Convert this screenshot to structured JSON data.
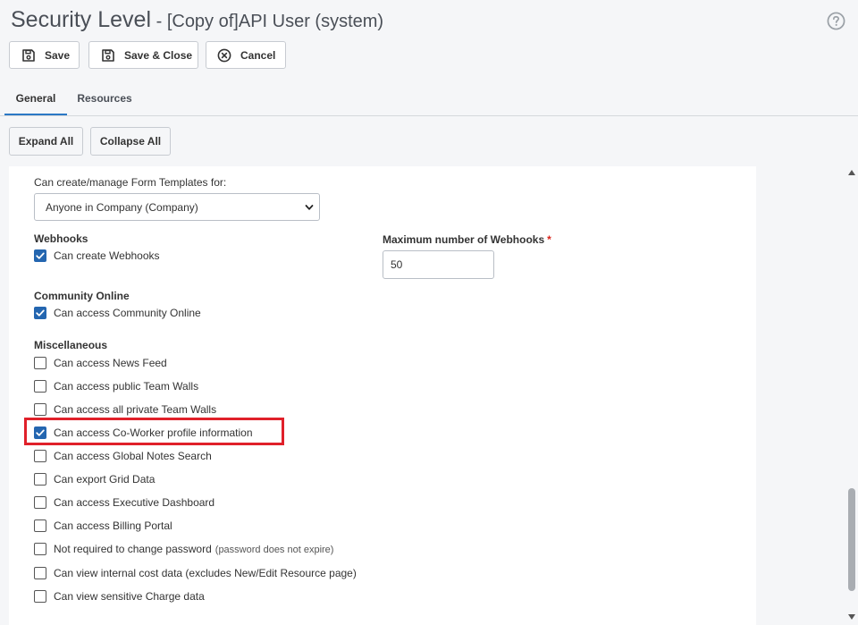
{
  "header": {
    "title": "Security Level",
    "separator": " - ",
    "subtitle": "[Copy of]API User (system)"
  },
  "toolbar": {
    "save_label": "Save",
    "save_close_label": "Save & Close",
    "cancel_label": "Cancel"
  },
  "tabs": [
    {
      "label": "General",
      "active": true
    },
    {
      "label": "Resources",
      "active": false
    }
  ],
  "actions": {
    "expand_label": "Expand All",
    "collapse_label": "Collapse All"
  },
  "form_templates": {
    "label": "Can create/manage Form Templates for:",
    "selected": "Anyone in Company (Company)"
  },
  "webhooks": {
    "heading": "Webhooks",
    "checkbox_label": "Can create Webhooks",
    "checked": true,
    "max_label": "Maximum number of Webhooks",
    "required_mark": "*",
    "max_value": "50"
  },
  "community": {
    "heading": "Community Online",
    "checkbox_label": "Can access Community Online",
    "checked": true
  },
  "misc": {
    "heading": "Miscellaneous",
    "items": [
      {
        "label": "Can access News Feed",
        "note": "",
        "checked": false
      },
      {
        "label": "Can access public Team Walls",
        "note": "",
        "checked": false
      },
      {
        "label": "Can access all private Team Walls",
        "note": "",
        "checked": false
      },
      {
        "label": "Can access Co-Worker profile information",
        "note": "",
        "checked": true
      },
      {
        "label": "Can access Global Notes Search",
        "note": "",
        "checked": false
      },
      {
        "label": "Can export Grid Data",
        "note": "",
        "checked": false
      },
      {
        "label": "Can access Executive Dashboard",
        "note": "",
        "checked": false
      },
      {
        "label": "Can access Billing Portal",
        "note": "",
        "checked": false
      },
      {
        "label": "Not required to change password",
        "note": "(password does not expire)",
        "checked": false
      },
      {
        "label": "Can view internal cost data (excludes New/Edit Resource page)",
        "note": "",
        "checked": false
      },
      {
        "label": "Can view sensitive Charge data",
        "note": "",
        "checked": false
      }
    ]
  },
  "colors": {
    "accent": "#2466b0",
    "highlight": "#e0202a",
    "required": "#d9251c"
  }
}
